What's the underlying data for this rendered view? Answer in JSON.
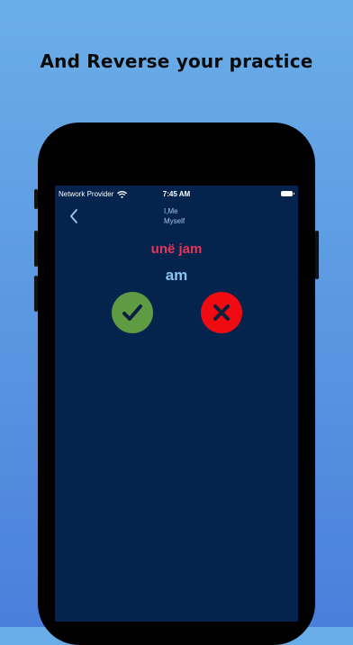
{
  "promo": {
    "headline": "And Reverse your practice"
  },
  "status_bar": {
    "carrier": "Network Provider",
    "time": "7:45 AM"
  },
  "nav": {
    "title_line1": "I,Me",
    "title_line2": "Myself"
  },
  "card": {
    "word_albanian": "unë jam",
    "word_english": "am"
  },
  "actions": {
    "correct_icon": "checkmark-icon",
    "wrong_icon": "cross-icon"
  },
  "colors": {
    "background_top": "#6aaee9",
    "background_bottom": "#4a7fdc",
    "screen_bg": "#04244d",
    "albanian_text": "#e93357",
    "english_text": "#8cc3f0",
    "correct": "#5f9b43",
    "wrong": "#f00a12"
  }
}
